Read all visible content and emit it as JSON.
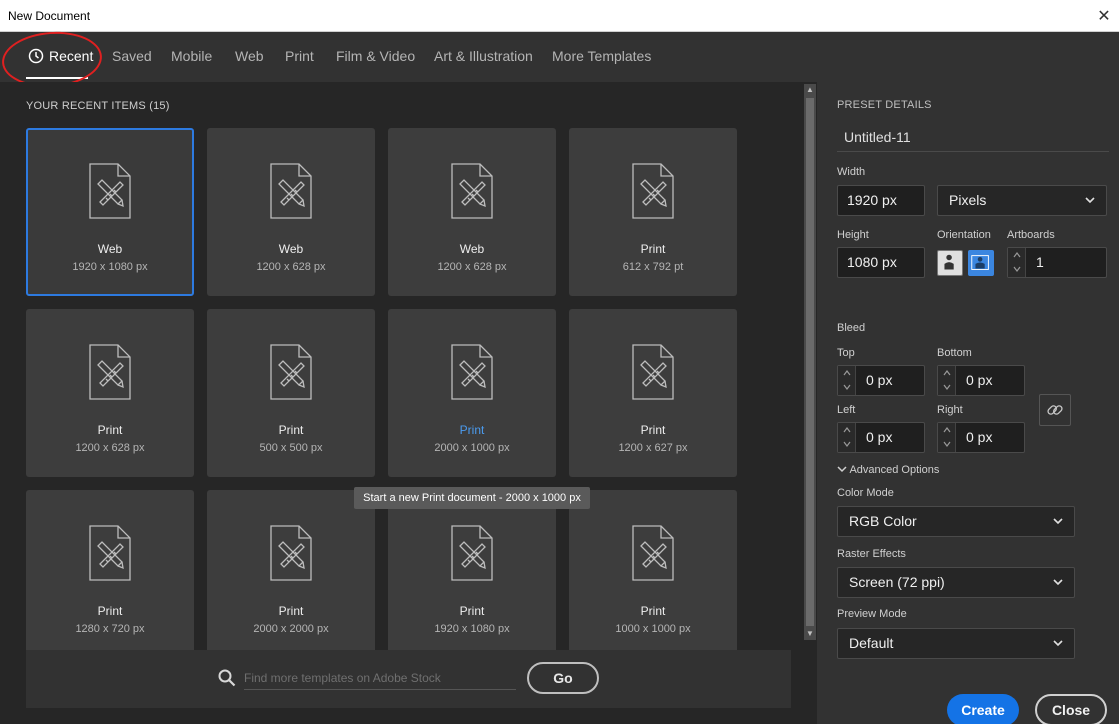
{
  "window": {
    "title": "New Document",
    "close_glyph": "✕"
  },
  "tabs": [
    {
      "label": "Recent",
      "active": true,
      "icon": "clock-icon"
    },
    {
      "label": "Saved"
    },
    {
      "label": "Mobile"
    },
    {
      "label": "Web"
    },
    {
      "label": "Print"
    },
    {
      "label": "Film & Video"
    },
    {
      "label": "Art & Illustration"
    },
    {
      "label": "More Templates"
    }
  ],
  "recent": {
    "title": "YOUR RECENT ITEMS",
    "count": "(15)",
    "items": [
      {
        "name": "Web",
        "size": "1920 x 1080 px",
        "selected": true
      },
      {
        "name": "Web",
        "size": "1200 x 628 px"
      },
      {
        "name": "Web",
        "size": "1200 x 628 px"
      },
      {
        "name": "Print",
        "size": "612 x 792 pt"
      },
      {
        "name": "Print",
        "size": "1200 x 628 px"
      },
      {
        "name": "Print",
        "size": "500 x 500 px"
      },
      {
        "name": "Print",
        "size": "2000 x 1000 px",
        "highlighted": true
      },
      {
        "name": "Print",
        "size": "1200 x 627 px"
      },
      {
        "name": "Print",
        "size": "1280 x 720 px"
      },
      {
        "name": "Print",
        "size": "2000 x 2000 px"
      },
      {
        "name": "Print",
        "size": "1920 x 1080 px"
      },
      {
        "name": "Print",
        "size": "1000 x 1000 px"
      }
    ],
    "tooltip": "Start a new Print document - 2000 x 1000 px"
  },
  "search": {
    "placeholder": "Find more templates on Adobe Stock",
    "go_label": "Go"
  },
  "preset": {
    "title": "PRESET DETAILS",
    "name": "Untitled-11",
    "width_label": "Width",
    "width_value": "1920 px",
    "units": "Pixels",
    "height_label": "Height",
    "height_value": "1080 px",
    "orientation_label": "Orientation",
    "artboards_label": "Artboards",
    "artboards_value": "1",
    "bleed_label": "Bleed",
    "top_label": "Top",
    "top_value": "0 px",
    "bottom_label": "Bottom",
    "bottom_value": "0 px",
    "left_label": "Left",
    "left_value": "0 px",
    "right_label": "Right",
    "right_value": "0 px",
    "advanced_label": "Advanced Options",
    "color_mode_label": "Color Mode",
    "color_mode": "RGB Color",
    "raster_label": "Raster Effects",
    "raster": "Screen (72 ppi)",
    "preview_label": "Preview Mode",
    "preview": "Default",
    "create_label": "Create",
    "close_label": "Close"
  },
  "colors": {
    "accent": "#1473e6",
    "selection": "#2d7ae0",
    "highlight": "#4b9cf0",
    "annotation": "#e02020"
  }
}
